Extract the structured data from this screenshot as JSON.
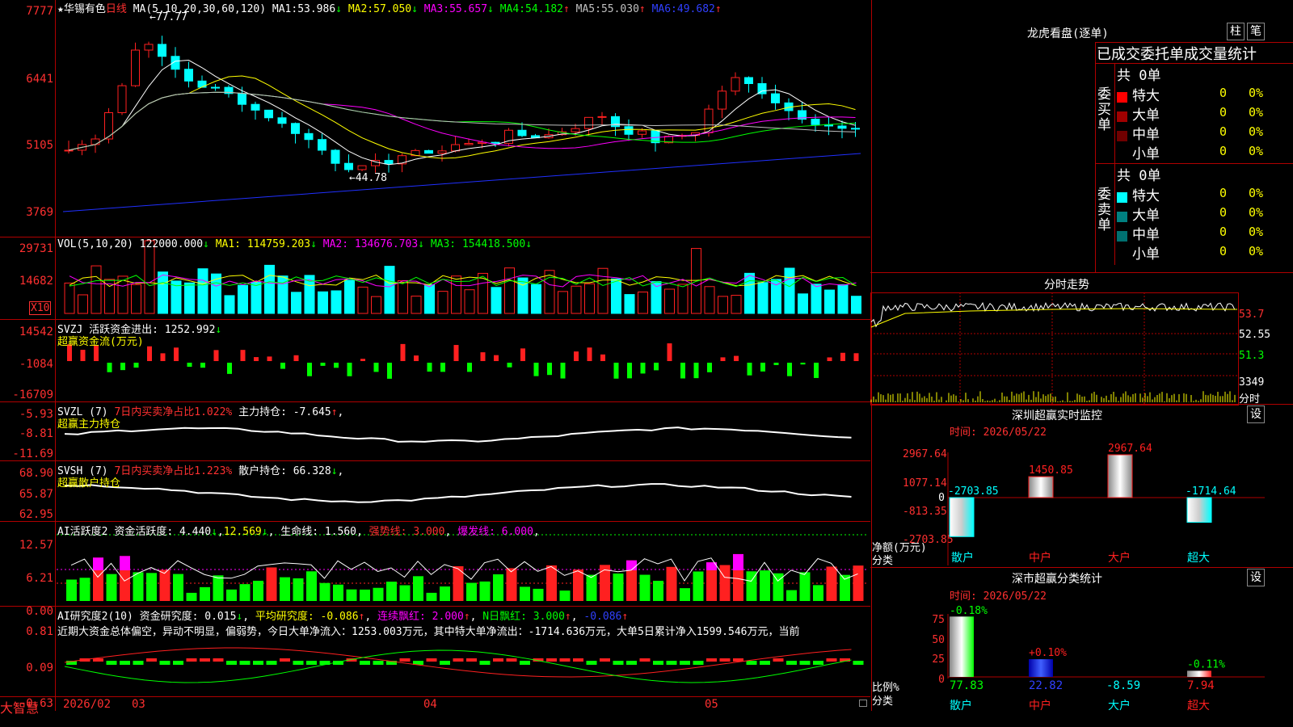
{
  "stock": {
    "star": "★",
    "name": "华锡有色",
    "period": "日线"
  },
  "main": {
    "y_ticks": [
      "7777",
      "6441",
      "5105",
      "3769"
    ],
    "ma_header": "MA(5,10,20,30,60,120)",
    "ma": [
      {
        "label": "MA1:",
        "value": "53.986",
        "arrow": "↓",
        "color": "#ffffff"
      },
      {
        "label": "MA2:",
        "value": "57.050",
        "arrow": "↓",
        "color": "#ffff00"
      },
      {
        "label": "MA3:",
        "value": "55.657",
        "arrow": "↓",
        "color": "#ff00ff"
      },
      {
        "label": "MA4:",
        "value": "54.182",
        "arrow": "↑",
        "color": "#00ff00"
      },
      {
        "label": "MA5:",
        "value": "55.030",
        "arrow": "↑",
        "color": "#c0c0c0"
      },
      {
        "label": "MA6:",
        "value": "49.682",
        "arrow": "↑",
        "color": "#2030ff"
      }
    ],
    "high_mark": "77.77",
    "low_mark": "44.78"
  },
  "vol": {
    "header": "VOL(5,10,20)",
    "value": "122000.000",
    "arrow": "↓",
    "ma1": "MA1: 114759.203",
    "ma1_arrow": "↓",
    "ma2": "MA2: 134676.703",
    "ma2_arrow": "↓",
    "ma3": "MA3: 154418.500",
    "ma3_arrow": "↓",
    "y_ticks": [
      "29731",
      "14682"
    ],
    "unit": "X10"
  },
  "svzj": {
    "name": "SVZJ",
    "label": "活跃资金进出:",
    "value": "1252.992",
    "arrow": "↓",
    "sub": "超赢资金流(万元)",
    "y_ticks": [
      "14542",
      "-1084",
      "-16709"
    ]
  },
  "svzl": {
    "name": "SVZL (7)",
    "label": "7日内买卖净占比1.022%",
    "label2": "主力持仓:",
    "value": "-7.645",
    "arrow": "↑",
    "comma": ",",
    "sub": "超赢主力持仓",
    "y_ticks": [
      "-5.93",
      "-8.81",
      "-11.69"
    ]
  },
  "svsh": {
    "name": "SVSH (7)",
    "label": "7日内买卖净占比1.223%",
    "label2": "散户持仓:",
    "value": "66.328",
    "arrow": "↓",
    "comma": ",",
    "sub": "超赢散户持仓",
    "y_ticks": [
      "68.90",
      "65.87",
      "62.95"
    ]
  },
  "ai1": {
    "name": "AI活跃度2",
    "label": "资金活跃度:",
    "value": "4.440",
    "arrow": "↓",
    "v2": "12.569",
    "l3": "生命线:",
    "v3": "1.560",
    "l4": "强势线: 3.000",
    "l5": "爆发线: 6.000",
    "y_ticks": [
      "12.57",
      "6.21",
      "0.00"
    ]
  },
  "ai2": {
    "name": "AI研究度2(10)",
    "label": "资金研究度:",
    "value": "0.015",
    "arrow": "↓",
    "avg": "平均研究度: -0.086",
    "avg_arrow": "↑",
    "lx": "连续飘红: 2.000",
    "lx_arrow": "↑",
    "nr": "N日飘红: 3.000",
    "nr_arrow": "↑",
    "last": "-0.086",
    "last_arrow": "↑",
    "desc": "近期大资金总体偏空，异动不明显，偏弱势，今日大单净流入：1253.003万元，其中特大单净流出：-1714.636万元，大单5日累计净入1599.546万元，当前",
    "y_ticks": [
      "0.81",
      "0.09",
      "-0.63"
    ]
  },
  "xaxis": {
    "brand": "大智慧",
    "labels": [
      "2026/02",
      "03",
      "04",
      "05"
    ]
  },
  "longhu": {
    "title": "龙虎看盘(逐单)",
    "btn1": "柱",
    "btn2": "笔",
    "table_title": "已成交委托单成交量统计",
    "buy_label": "委买单",
    "sell_label": "委卖单",
    "buy_total": "共 0单",
    "sell_total": "共 0单",
    "buy_rows": [
      {
        "name": "特大",
        "vol": "0",
        "pct": "0%",
        "color": "#ff0000"
      },
      {
        "name": "大单",
        "vol": "0",
        "pct": "0%",
        "color": "#a00000"
      },
      {
        "name": "中单",
        "vol": "0",
        "pct": "0%",
        "color": "#700000"
      },
      {
        "name": "小单",
        "vol": "0",
        "pct": "0%",
        "color": ""
      }
    ],
    "sell_rows": [
      {
        "name": "特大",
        "vol": "0",
        "pct": "0%",
        "color": "#00ffff"
      },
      {
        "name": "大单",
        "vol": "0",
        "pct": "0%",
        "color": "#008080"
      },
      {
        "name": "中单",
        "vol": "0",
        "pct": "0%",
        "color": "#007070"
      },
      {
        "name": "小单",
        "vol": "0",
        "pct": "0%",
        "color": ""
      }
    ]
  },
  "fenshi": {
    "title": "分时走势",
    "y_ticks": [
      "53.7",
      "52.55",
      "51.3"
    ],
    "vol_tick": "3349",
    "vol_label": "分时"
  },
  "monitor": {
    "title": "深圳超赢实时监控",
    "settings": "设",
    "time": "时间: 2026/05/22",
    "y_ticks": [
      "2967.64",
      "1077.14",
      "0",
      "-813.35",
      "-2703.85"
    ],
    "bars": [
      {
        "name": "散户",
        "value": "-2703.85"
      },
      {
        "name": "中户",
        "value": "1450.85"
      },
      {
        "name": "大户",
        "value": "2967.64"
      },
      {
        "name": "超大",
        "value": "-1714.64"
      }
    ],
    "ylabel": "净额(万元)",
    "xlabel": "分类"
  },
  "classify": {
    "title": "深市超赢分类统计",
    "settings": "设",
    "time": "时间: 2026/05/22",
    "y_ticks": [
      "75",
      "50",
      "25",
      "0"
    ],
    "bars": [
      {
        "name": "散户",
        "value": "77.83",
        "pct": "-0.18%"
      },
      {
        "name": "中户",
        "value": "22.82",
        "pct": "+0.10%"
      },
      {
        "name": "大户",
        "value": "-8.59",
        "pct": ""
      },
      {
        "name": "超大",
        "value": "7.94",
        "pct": "-0.11%"
      }
    ],
    "ylabel": "比例%",
    "xlabel": "分类"
  },
  "colors": {
    "up": "#ff2020",
    "down": "#00ffff",
    "grid": "#b00000"
  }
}
